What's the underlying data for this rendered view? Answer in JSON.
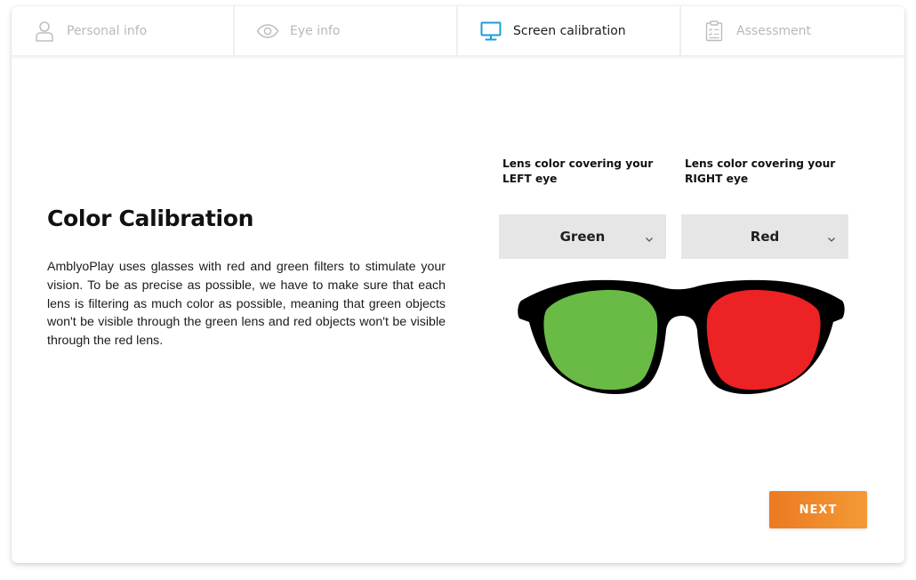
{
  "steps": [
    {
      "label": "Personal info",
      "icon": "user-icon",
      "active": false
    },
    {
      "label": "Eye info",
      "icon": "eye-icon",
      "active": false
    },
    {
      "label": "Screen calibration",
      "icon": "monitor-icon",
      "active": true
    },
    {
      "label": "Assessment",
      "icon": "clipboard-icon",
      "active": false
    }
  ],
  "main": {
    "title": "Color Calibration",
    "description": "AmblyoPlay uses glasses with red and green filters to stimulate your vision. To be as precise as possible, we have to make sure that each lens is filtering as much color as possible, meaning that green objects won't be visible through the green lens and red objects won't be visible through the red lens."
  },
  "left_eye": {
    "label": "Lens color covering your LEFT eye",
    "selected": "Green"
  },
  "right_eye": {
    "label": "Lens color covering your RIGHT eye",
    "selected": "Red"
  },
  "next_label": "NEXT",
  "colors": {
    "accent": "#1a9fd8",
    "next_gradient_start": "#ec7a22",
    "next_gradient_end": "#f39a35",
    "green_lens": "#69bb45",
    "red_lens": "#ed2224",
    "frame": "#000000",
    "select_bg": "#e6e6e6"
  }
}
